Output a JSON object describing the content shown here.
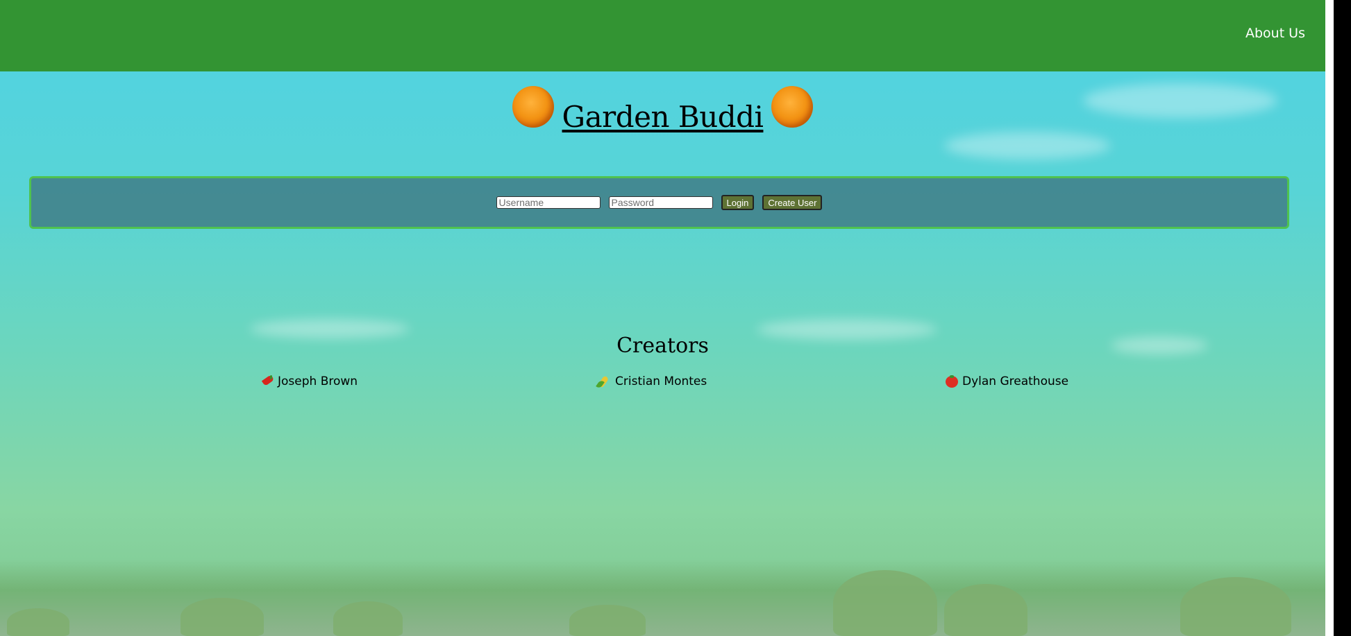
{
  "nav": {
    "about_label": "About Us"
  },
  "header": {
    "title": "Garden Buddi"
  },
  "login": {
    "username_placeholder": "Username",
    "password_placeholder": "Password",
    "login_label": "Login",
    "create_user_label": "Create User"
  },
  "creators": {
    "heading": "Creators",
    "people": [
      {
        "name": "Joseph Brown",
        "icon": "pepper-icon"
      },
      {
        "name": "Cristian Montes",
        "icon": "corn-icon"
      },
      {
        "name": "Dylan Greathouse",
        "icon": "tomato-icon"
      }
    ]
  },
  "colors": {
    "topbar": "#339433",
    "panel_border": "#4fc24f",
    "button": "#5e7234"
  }
}
